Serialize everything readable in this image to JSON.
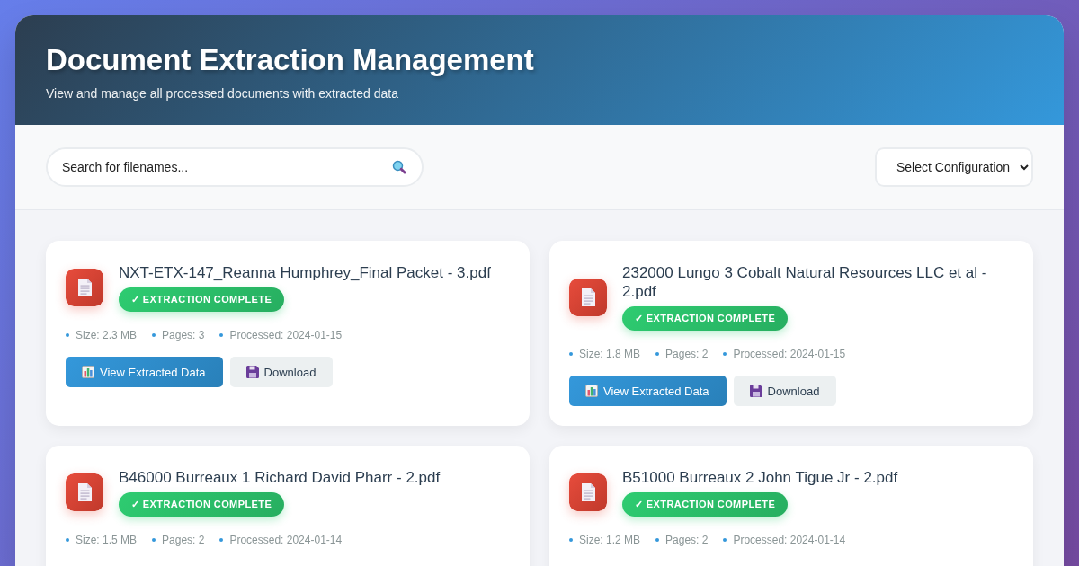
{
  "header": {
    "title": "Document Extraction Management",
    "subtitle": "View and manage all processed documents with extracted data"
  },
  "search": {
    "placeholder": "Search for filenames..."
  },
  "config_select": {
    "value": "Select Configuration"
  },
  "documents": [
    {
      "filename": "NXT-ETX-147_Reanna Humphrey_Final Packet - 3.pdf",
      "status": {
        "kind": "complete",
        "label": "✓ EXTRACTION COMPLETE"
      },
      "meta": [
        "Size: 2.3 MB",
        "Pages: 3",
        "Processed: 2024-01-15"
      ],
      "actions": [
        {
          "kind": "view",
          "label": "View Extracted Data"
        },
        {
          "kind": "download",
          "label": "Download"
        }
      ]
    },
    {
      "filename": "232000 Lungo 3 Cobalt Natural Resources LLC et al - 2.pdf",
      "status": {
        "kind": "complete",
        "label": "✓ EXTRACTION COMPLETE"
      },
      "meta": [
        "Size: 1.8 MB",
        "Pages: 2",
        "Processed: 2024-01-15"
      ],
      "actions": [
        {
          "kind": "view",
          "label": "View Extracted Data"
        },
        {
          "kind": "download",
          "label": "Download"
        }
      ]
    },
    {
      "filename": "B46000 Burreaux 1 Richard David Pharr - 2.pdf",
      "status": {
        "kind": "complete",
        "label": "✓ EXTRACTION COMPLETE"
      },
      "meta": [
        "Size: 1.5 MB",
        "Pages: 2",
        "Processed: 2024-01-14"
      ]
    },
    {
      "filename": "B51000 Burreaux 2 John Tigue Jr - 2.pdf",
      "status": {
        "kind": "complete",
        "label": "✓ EXTRACTION COMPLETE"
      },
      "meta": [
        "Size: 1.2 MB",
        "Pages: 2",
        "Processed: 2024-01-14"
      ]
    }
  ]
}
